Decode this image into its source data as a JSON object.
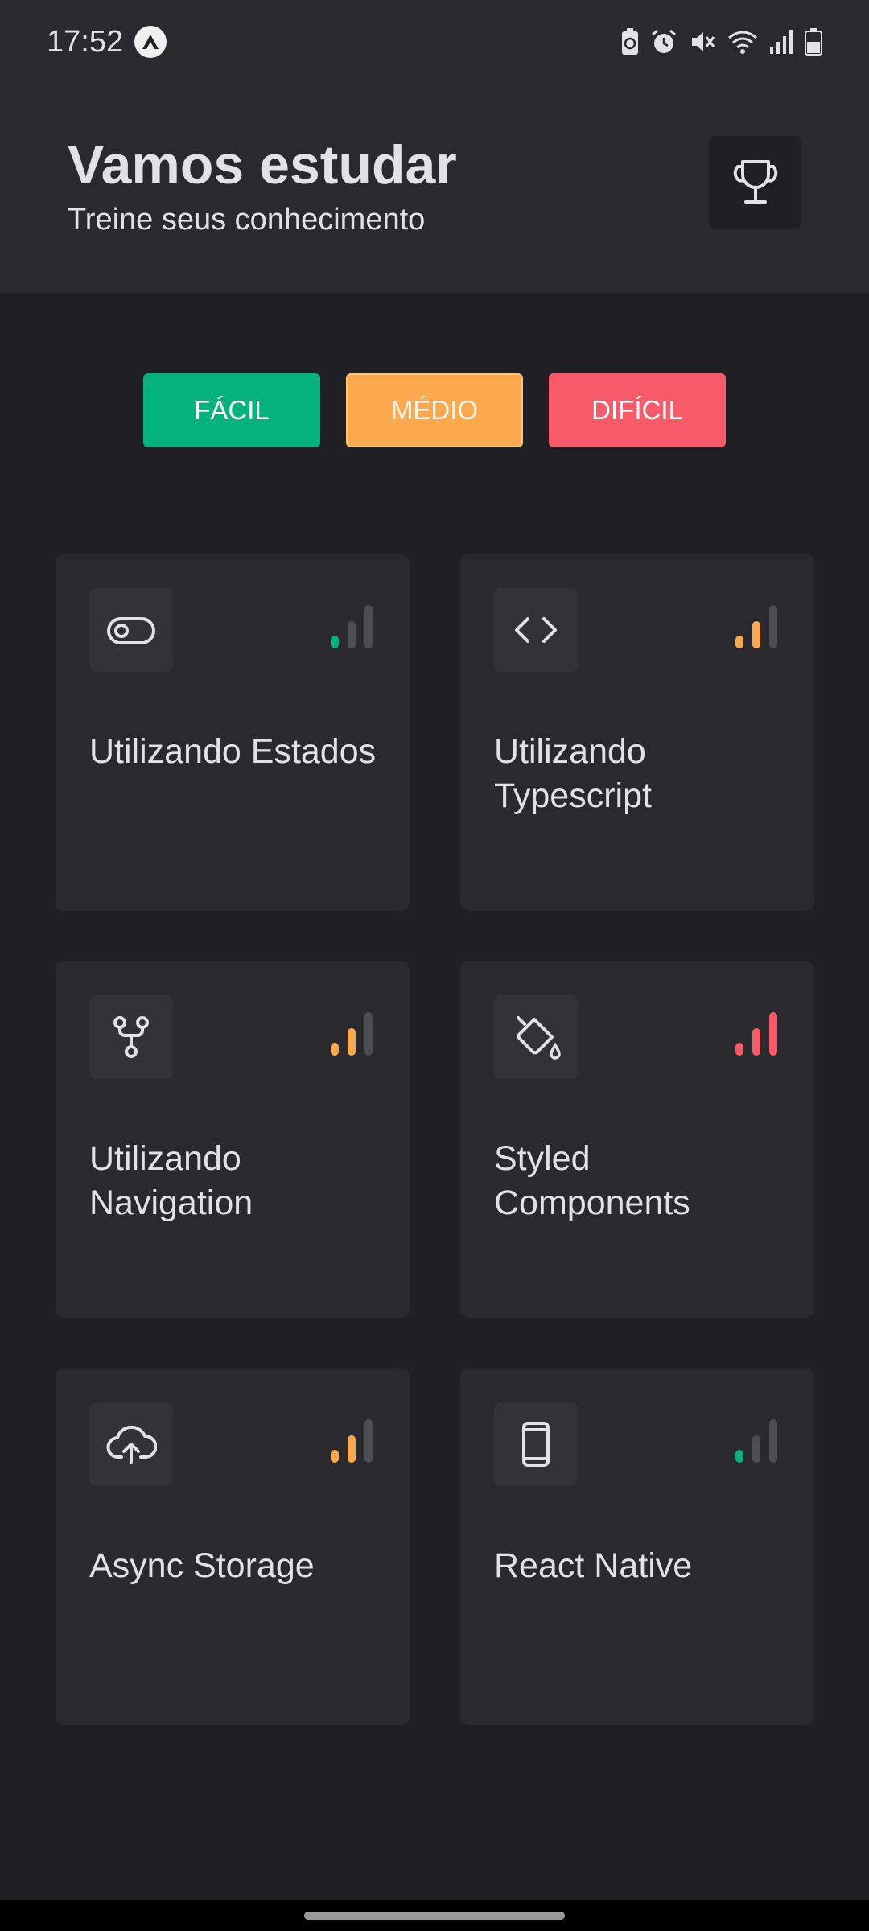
{
  "status_bar": {
    "time": "17:52",
    "icons": [
      "app-icon",
      "battery-saver-icon",
      "alarm-icon",
      "mute-icon",
      "wifi-icon",
      "signal-icon",
      "battery-icon"
    ]
  },
  "header": {
    "title": "Vamos estudar",
    "subtitle": "Treine seus conhecimento",
    "trophy_icon": "trophy-icon"
  },
  "filters": [
    {
      "label": "FÁCIL",
      "color": "#04b37a"
    },
    {
      "label": "MÉDIO",
      "color": "#fba94c"
    },
    {
      "label": "DIFÍCIL",
      "color": "#f75a68"
    }
  ],
  "levels": {
    "easy": {
      "bars": 1,
      "color": "#04b37a"
    },
    "medium": {
      "bars": 2,
      "color": "#fba94c"
    },
    "hard": {
      "bars": 3,
      "color": "#f75a68"
    }
  },
  "quizzes": [
    {
      "title": "Utilizando Estados",
      "icon": "toggle-icon",
      "level": "easy"
    },
    {
      "title": "Utilizando Typescript",
      "icon": "code-icon",
      "level": "medium"
    },
    {
      "title": "Utilizando Navigation",
      "icon": "git-fork-icon",
      "level": "medium"
    },
    {
      "title": "Styled Components",
      "icon": "paint-bucket-icon",
      "level": "hard"
    },
    {
      "title": "Async Storage",
      "icon": "cloud-upload-icon",
      "level": "medium"
    },
    {
      "title": "React Native",
      "icon": "device-mobile-icon",
      "level": "easy"
    }
  ]
}
